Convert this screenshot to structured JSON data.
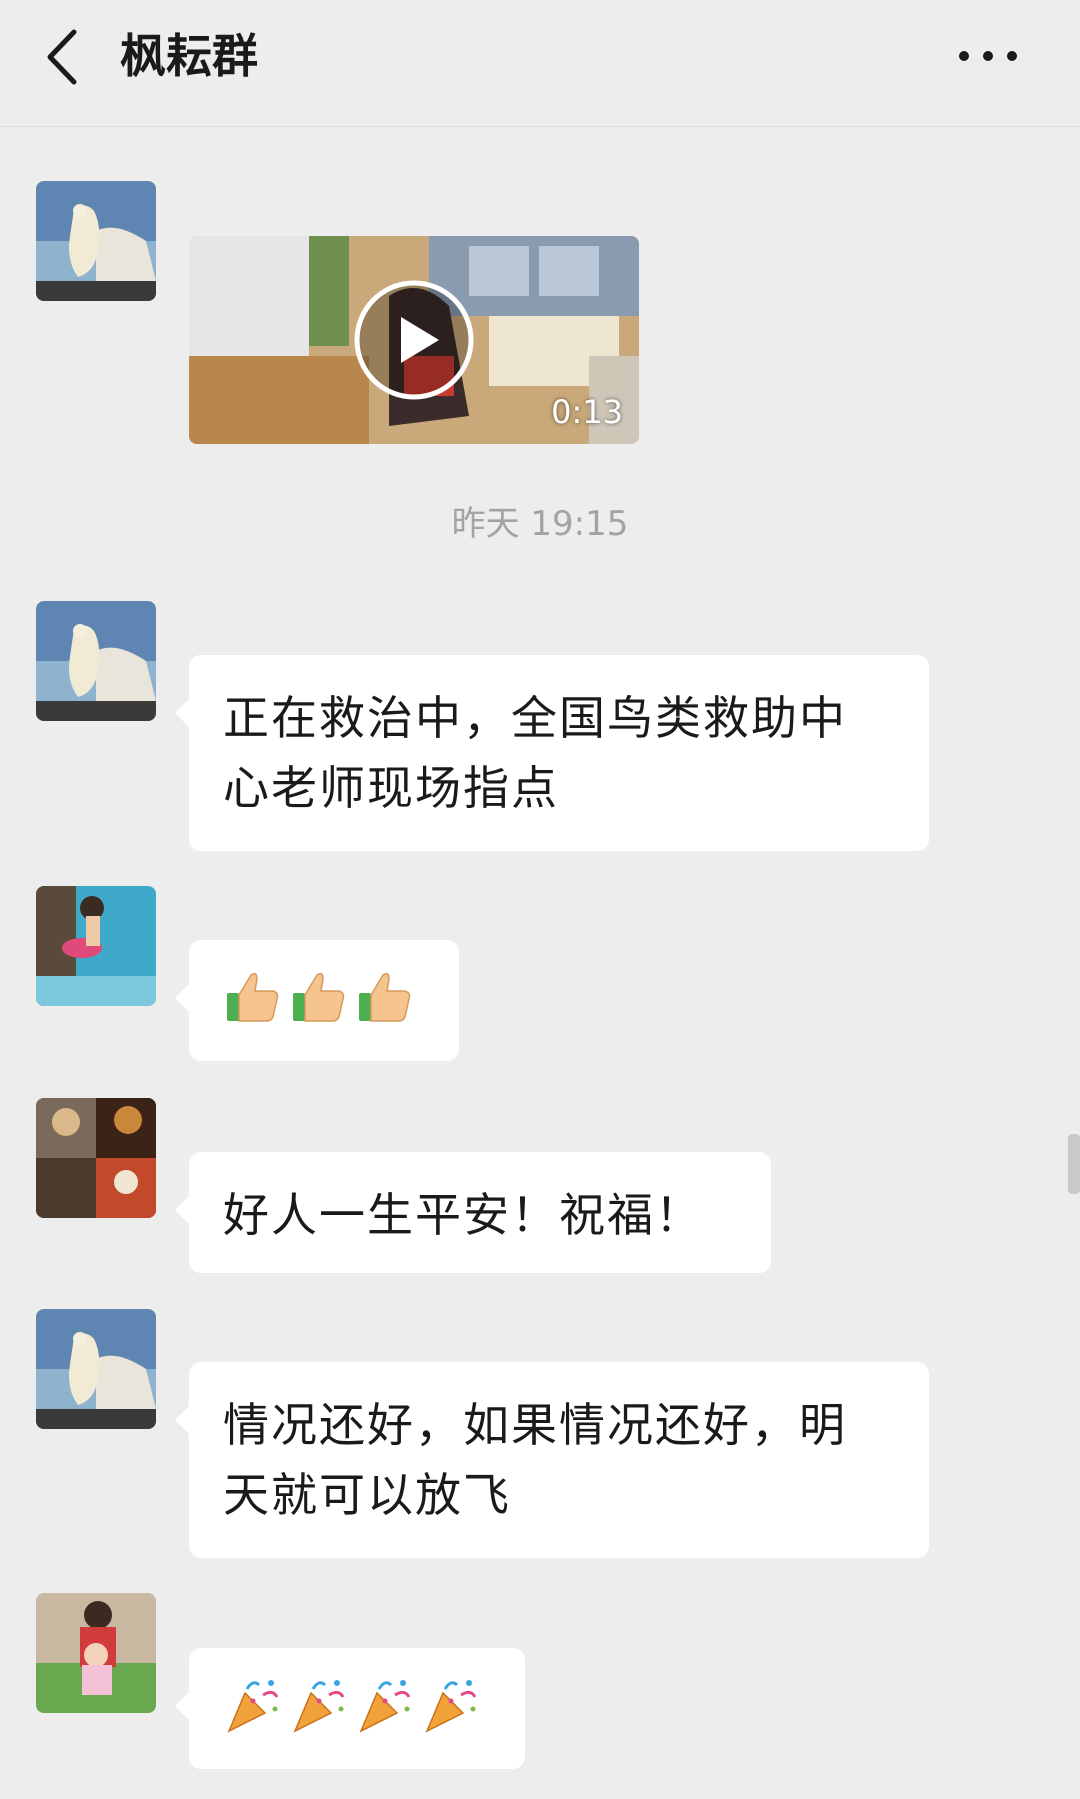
{
  "header": {
    "title": "枫耘群",
    "back_icon": "back-arrow-icon",
    "more_icon": "more-dots-icon"
  },
  "messages": [
    {
      "type": "video",
      "sender_avatar": "polar-bear-avatar",
      "video": {
        "duration": "0:13",
        "play_icon": "play-icon"
      }
    },
    {
      "type": "timestamp",
      "text": "昨天 19:15"
    },
    {
      "type": "text",
      "sender_avatar": "polar-bear-avatar",
      "lines": [
        "正在救治中，全国鸟类救助中",
        "心老师现场指点"
      ]
    },
    {
      "type": "emoji",
      "sender_avatar": "child-pool-avatar",
      "emoji": [
        "thumbs-up-icon",
        "thumbs-up-icon",
        "thumbs-up-icon"
      ]
    },
    {
      "type": "text",
      "sender_avatar": "rock-band-avatar",
      "lines": [
        "好人一生平安！祝福！"
      ]
    },
    {
      "type": "text",
      "sender_avatar": "polar-bear-avatar",
      "lines": [
        "情况还好，如果情况还好，明",
        "天就可以放飞"
      ]
    },
    {
      "type": "emoji",
      "sender_avatar": "family-avatar",
      "emoji": [
        "party-popper-icon",
        "party-popper-icon",
        "party-popper-icon",
        "party-popper-icon"
      ]
    }
  ],
  "colors": {
    "background": "#ededed",
    "bubble": "#ffffff",
    "timestamp": "#a3a3a3",
    "text": "#1a1a1a"
  }
}
